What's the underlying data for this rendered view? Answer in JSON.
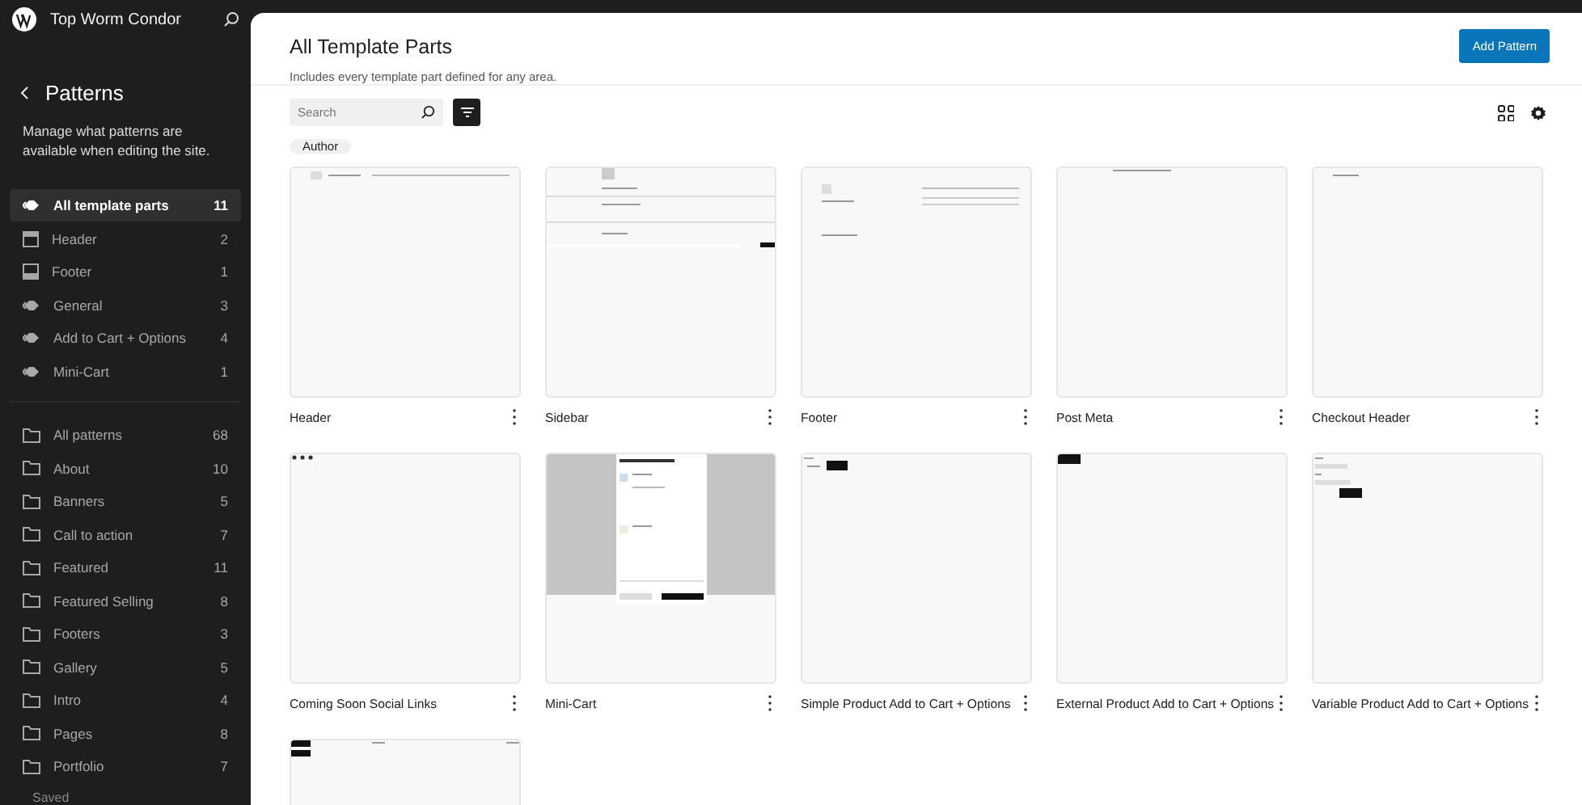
{
  "site": {
    "title": "Top Worm Condor"
  },
  "sidebar": {
    "back_title": "Patterns",
    "description": "Manage what patterns are available when editing the site.",
    "template_parts": [
      {
        "kind": "diamond",
        "label": "All template parts",
        "count": "11",
        "selected": true
      },
      {
        "kind": "header",
        "label": "Header",
        "count": "2",
        "selected": false
      },
      {
        "kind": "footer",
        "label": "Footer",
        "count": "1",
        "selected": false
      },
      {
        "kind": "diamond",
        "label": "General",
        "count": "3",
        "selected": false
      },
      {
        "kind": "diamond",
        "label": "Add to Cart + Options",
        "count": "4",
        "selected": false
      },
      {
        "kind": "diamond",
        "label": "Mini-Cart",
        "count": "1",
        "selected": false
      }
    ],
    "categories": [
      {
        "label": "All patterns",
        "count": "68",
        "selected": false
      },
      {
        "label": "About",
        "count": "10",
        "selected": false
      },
      {
        "label": "Banners",
        "count": "5",
        "selected": false
      },
      {
        "label": "Call to action",
        "count": "7",
        "selected": false
      },
      {
        "label": "Featured",
        "count": "11",
        "selected": false
      },
      {
        "label": "Featured Selling",
        "count": "8",
        "selected": false
      },
      {
        "label": "Footers",
        "count": "3",
        "selected": false
      },
      {
        "label": "Gallery",
        "count": "5",
        "selected": false
      },
      {
        "label": "Intro",
        "count": "4",
        "selected": false
      },
      {
        "label": "Pages",
        "count": "8",
        "selected": false
      },
      {
        "label": "Portfolio",
        "count": "7",
        "selected": false
      }
    ],
    "status": "Saved"
  },
  "main": {
    "title": "All Template Parts",
    "subtitle": "Includes every template part defined for any area.",
    "add_button": "Add Pattern",
    "search": {
      "placeholder": "Search"
    },
    "filter_chip": "Author",
    "cards": [
      {
        "kind": "header",
        "title": "Header"
      },
      {
        "kind": "sidebar",
        "title": "Sidebar"
      },
      {
        "kind": "footer",
        "title": "Footer"
      },
      {
        "kind": "meta",
        "title": "Post Meta"
      },
      {
        "kind": "checkout",
        "title": "Checkout Header"
      },
      {
        "kind": "social",
        "title": "Coming Soon Social Links"
      },
      {
        "kind": "minicart",
        "title": "Mini-Cart"
      },
      {
        "kind": "simple",
        "title": "Simple Product Add to Cart + Options"
      },
      {
        "kind": "external",
        "title": "External Product Add to Cart + Options"
      },
      {
        "kind": "variable",
        "title": "Variable Product Add to Cart + Options"
      },
      {
        "kind": "grouped"
      }
    ]
  }
}
